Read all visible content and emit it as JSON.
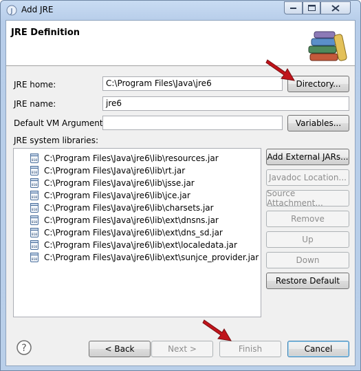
{
  "window": {
    "title": "Add JRE",
    "controls": {
      "minimize": "minimize",
      "maximize": "maximize",
      "close": "close"
    }
  },
  "header": {
    "title": "JRE Definition",
    "icon": "books-icon"
  },
  "form": {
    "jre_home_label": "JRE home:",
    "jre_home_value": "C:\\Program Files\\Java\\jre6",
    "directory_button": "Directory...",
    "jre_name_label": "JRE name:",
    "jre_name_value": "jre6",
    "vm_args_label": "Default VM Arguments:",
    "vm_args_value": "",
    "variables_button": "Variables..."
  },
  "libraries": {
    "label": "JRE system libraries:",
    "items": [
      "C:\\Program Files\\Java\\jre6\\lib\\resources.jar",
      "C:\\Program Files\\Java\\jre6\\lib\\rt.jar",
      "C:\\Program Files\\Java\\jre6\\lib\\jsse.jar",
      "C:\\Program Files\\Java\\jre6\\lib\\jce.jar",
      "C:\\Program Files\\Java\\jre6\\lib\\charsets.jar",
      "C:\\Program Files\\Java\\jre6\\lib\\ext\\dnsns.jar",
      "C:\\Program Files\\Java\\jre6\\lib\\ext\\dns_sd.jar",
      "C:\\Program Files\\Java\\jre6\\lib\\ext\\localedata.jar",
      "C:\\Program Files\\Java\\jre6\\lib\\ext\\sunjce_provider.jar"
    ],
    "buttons": {
      "add_external": "Add External JARs...",
      "javadoc": "Javadoc Location...",
      "source": "Source Attachment...",
      "remove": "Remove",
      "up": "Up",
      "down": "Down",
      "restore": "Restore Default"
    }
  },
  "footer": {
    "back": "< Back",
    "next": "Next >",
    "finish": "Finish",
    "cancel": "Cancel"
  },
  "colors": {
    "arrow": "#c0141b",
    "title_bar": "#b9cfe9",
    "dialog_bg": "#f0f0f0"
  }
}
